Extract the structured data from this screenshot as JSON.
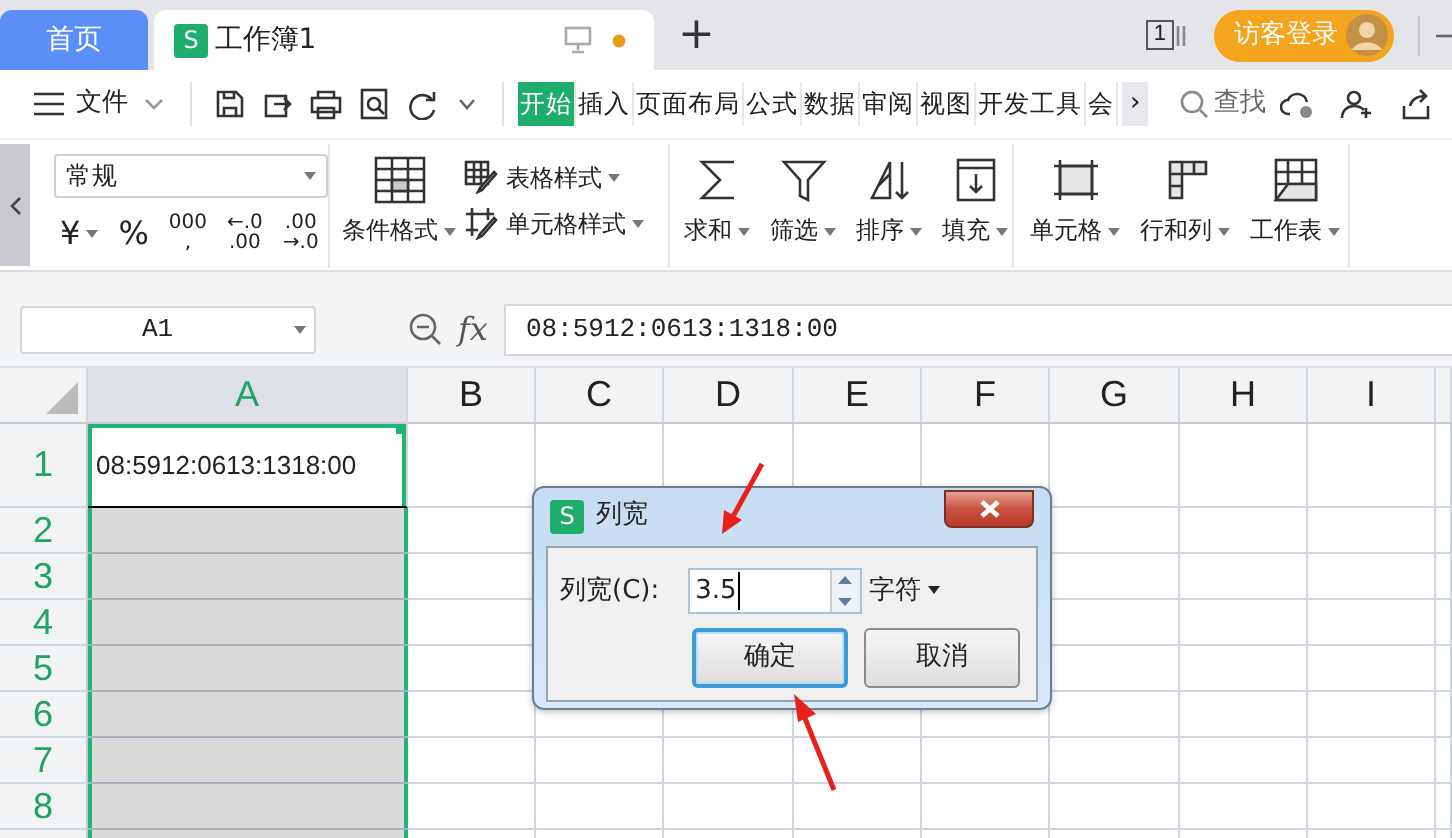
{
  "tabs": [
    {
      "kind": "home",
      "label": "首页",
      "selected": false
    },
    {
      "kind": "document",
      "label": "工作簿1",
      "icon_letter": "S",
      "selected": true
    }
  ],
  "new_tab": "+",
  "page_count": "1",
  "login": "访客登录",
  "toolbar": {
    "file_menu": "文件",
    "ribbon_tabs": [
      {
        "label": "开始",
        "selected": true
      },
      {
        "label": "插入",
        "selected": false
      },
      {
        "label": "页面布局",
        "selected": false
      },
      {
        "label": "公式",
        "selected": false
      },
      {
        "label": "数据",
        "selected": false
      },
      {
        "label": "审阅",
        "selected": false
      },
      {
        "label": "视图",
        "selected": false
      },
      {
        "label": "开发工具",
        "selected": false
      },
      {
        "label": "会",
        "selected": false
      }
    ],
    "more": "›",
    "search": "查找"
  },
  "ribbon": {
    "number_format": "常规",
    "format_buttons": [
      {
        "lines": [
          "¥"
        ],
        "dropdown": true
      },
      {
        "lines": [
          "%"
        ],
        "dropdown": false
      },
      {
        "lines": [
          "000",
          ","
        ],
        "dropdown": false
      },
      {
        "lines": [
          "←.0",
          ".00"
        ],
        "dropdown": false
      },
      {
        "lines": [
          ".00",
          "→.0"
        ],
        "dropdown": false
      }
    ],
    "conditional_format": {
      "label": "条件格式",
      "dropdown": true
    },
    "style_buttons": [
      {
        "kind": "table-style",
        "label": "表格样式",
        "dropdown": true
      },
      {
        "kind": "cell-style",
        "label": "单元格样式",
        "dropdown": true
      }
    ],
    "edit_buttons": [
      {
        "kind": "sum",
        "label": "求和",
        "dropdown": true
      },
      {
        "kind": "filter",
        "label": "筛选",
        "dropdown": true
      },
      {
        "kind": "sort",
        "label": "排序",
        "dropdown": true
      },
      {
        "kind": "fill",
        "label": "填充",
        "dropdown": true
      }
    ],
    "cell_buttons": [
      {
        "kind": "cell",
        "label": "单元格",
        "dropdown": true
      },
      {
        "kind": "rows-columns",
        "label": "行和列",
        "dropdown": true
      },
      {
        "kind": "sheet",
        "label": "工作表",
        "dropdown": true
      }
    ]
  },
  "formula_bar": {
    "name_box": "A1",
    "fx": "fx",
    "value": "08:5912:0613:1318:00"
  },
  "sheet": {
    "columns": [
      {
        "label": "A",
        "selected": true
      },
      {
        "label": "B",
        "selected": false
      },
      {
        "label": "C",
        "selected": false
      },
      {
        "label": "D",
        "selected": false
      },
      {
        "label": "E",
        "selected": false
      },
      {
        "label": "F",
        "selected": false
      },
      {
        "label": "G",
        "selected": false
      },
      {
        "label": "H",
        "selected": false
      },
      {
        "label": "I",
        "selected": false
      }
    ],
    "rows": [
      {
        "label": "1",
        "selected": true,
        "cells": [
          "08:5912:0613:1318:00"
        ]
      },
      {
        "label": "2",
        "selected": true
      },
      {
        "label": "3",
        "selected": true
      },
      {
        "label": "4",
        "selected": true
      },
      {
        "label": "5",
        "selected": true
      },
      {
        "label": "6",
        "selected": true
      },
      {
        "label": "7",
        "selected": true
      },
      {
        "label": "8",
        "selected": true
      }
    ]
  },
  "dialog": {
    "icon_letter": "S",
    "title": "列宽",
    "field_label": "列宽(C):",
    "value": "3.5",
    "unit": "字符",
    "ok": "确定",
    "cancel": "取消"
  }
}
